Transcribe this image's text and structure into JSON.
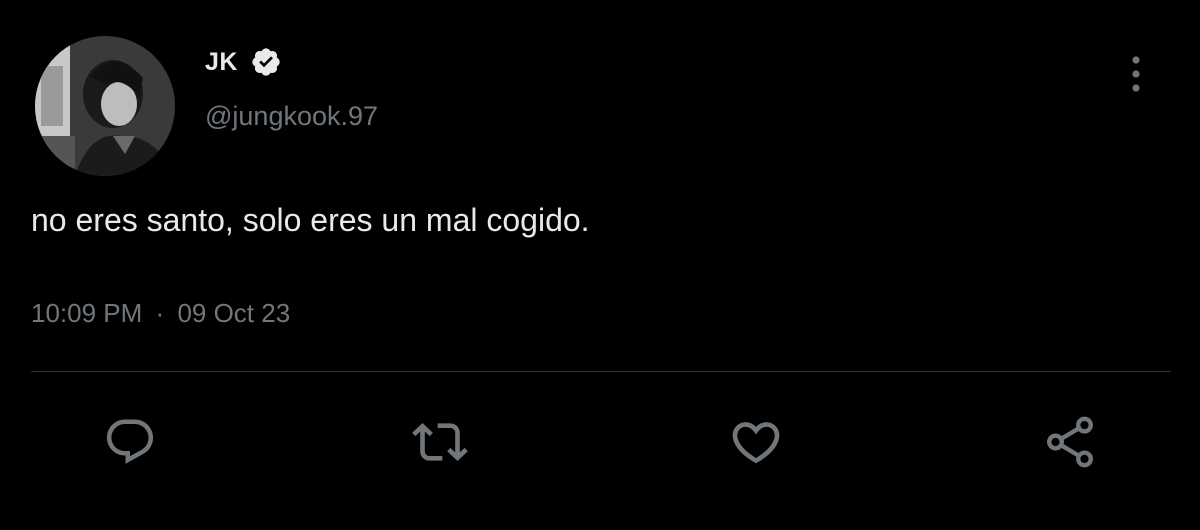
{
  "author": {
    "display_name": "JK",
    "handle": "@jungkook.97",
    "avatar_icon": "profile-photo",
    "verified_icon": "verified-badge-icon"
  },
  "tweet": {
    "text": "no eres santo, solo eres un mal cogido.",
    "time": "10:09 PM",
    "separator": "·",
    "date": "09 Oct 23"
  },
  "actions": [
    {
      "name": "reply",
      "icon": "reply-icon"
    },
    {
      "name": "retweet",
      "icon": "retweet-icon"
    },
    {
      "name": "like",
      "icon": "heart-icon"
    },
    {
      "name": "share",
      "icon": "share-icon"
    }
  ],
  "colors": {
    "background": "#000000",
    "primary_text": "#e7e9ea",
    "secondary_text": "#71767b",
    "divider": "#2f3336"
  }
}
